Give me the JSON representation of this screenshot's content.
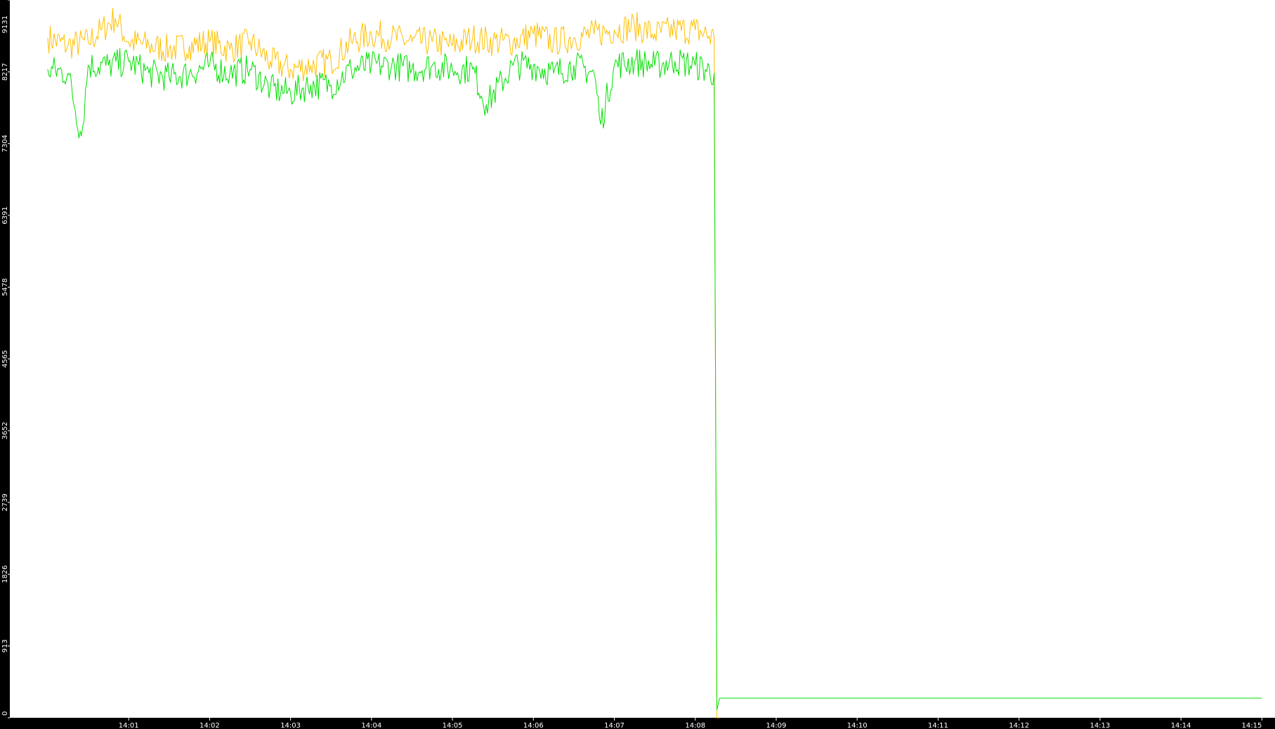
{
  "colors": {
    "background": "#000000",
    "plot_area": "#ffffff",
    "axis_text": "#ffffff",
    "series_orange": "#ffc000",
    "series_green": "#00e000"
  },
  "chart_data": {
    "type": "line",
    "title": "",
    "xlabel": "",
    "ylabel": "",
    "grid": false,
    "ylim": [
      0,
      9131
    ],
    "xlim_minutes": [
      13.9922,
      14.2527
    ],
    "y_ticks": [
      {
        "value": 0,
        "label": "0"
      },
      {
        "value": 913,
        "label": "913"
      },
      {
        "value": 1826,
        "label": "1826"
      },
      {
        "value": 2739,
        "label": "2739"
      },
      {
        "value": 3652,
        "label": "3652"
      },
      {
        "value": 4565,
        "label": "4565"
      },
      {
        "value": 5478,
        "label": "5478"
      },
      {
        "value": 6391,
        "label": "6391"
      },
      {
        "value": 7304,
        "label": "7304"
      },
      {
        "value": 8217,
        "label": "8217"
      },
      {
        "value": 9131,
        "label": "9131"
      }
    ],
    "x_ticks": [
      {
        "value": "14:01",
        "label": "14:01"
      },
      {
        "value": "14:02",
        "label": "14:02"
      },
      {
        "value": "14:03",
        "label": "14:03"
      },
      {
        "value": "14:04",
        "label": "14:04"
      },
      {
        "value": "14:05",
        "label": "14:05"
      },
      {
        "value": "14:06",
        "label": "14:06"
      },
      {
        "value": "14:07",
        "label": "14:07"
      },
      {
        "value": "14:08",
        "label": "14:08"
      },
      {
        "value": "14:09",
        "label": "14:09"
      },
      {
        "value": "14:10",
        "label": "14:10"
      },
      {
        "value": "14:11",
        "label": "14:11"
      },
      {
        "value": "14:12",
        "label": "14:12"
      },
      {
        "value": "14:13",
        "label": "14:13"
      },
      {
        "value": "14:14",
        "label": "14:14"
      },
      {
        "value": "14:15",
        "label": "14:15"
      }
    ],
    "series": [
      {
        "color": "#ffc000",
        "x": [
          "14:00:00",
          "14:00:15",
          "14:00:30",
          "14:00:40",
          "14:00:50",
          "14:01:00",
          "14:01:15",
          "14:01:30",
          "14:01:45",
          "14:02:00",
          "14:02:15",
          "14:02:30",
          "14:02:45",
          "14:03:00",
          "14:03:15",
          "14:03:30",
          "14:03:45",
          "14:04:00",
          "14:04:15",
          "14:04:30",
          "14:04:45",
          "14:05:00",
          "14:05:15",
          "14:05:30",
          "14:05:45",
          "14:06:00",
          "14:06:15",
          "14:06:30",
          "14:06:45",
          "14:07:00",
          "14:07:15",
          "14:07:30",
          "14:07:45",
          "14:08:00",
          "14:08:14",
          "14:08:16",
          "14:08:18"
        ],
        "y": [
          8650,
          8550,
          8600,
          8750,
          8900,
          8600,
          8550,
          8500,
          8550,
          8600,
          8500,
          8600,
          8350,
          8250,
          8300,
          8350,
          8600,
          8700,
          8650,
          8600,
          8600,
          8550,
          8650,
          8600,
          8600,
          8700,
          8600,
          8650,
          8700,
          8750,
          8800,
          8700,
          8750,
          8750,
          8650,
          0,
          0
        ]
      },
      {
        "color": "#00e000",
        "x": [
          "14:00:00",
          "14:00:15",
          "14:00:25",
          "14:00:30",
          "14:00:45",
          "14:01:00",
          "14:01:15",
          "14:01:30",
          "14:01:45",
          "14:02:00",
          "14:02:15",
          "14:02:30",
          "14:02:45",
          "14:03:00",
          "14:03:15",
          "14:03:30",
          "14:03:45",
          "14:04:00",
          "14:04:15",
          "14:04:30",
          "14:04:45",
          "14:05:00",
          "14:05:15",
          "14:05:25",
          "14:05:45",
          "14:06:00",
          "14:06:15",
          "14:06:30",
          "14:06:45",
          "14:06:50",
          "14:07:00",
          "14:07:15",
          "14:07:30",
          "14:07:45",
          "14:08:00",
          "14:08:14",
          "14:08:15",
          "14:08:16",
          "14:08:18",
          "14:15:00"
        ],
        "y": [
          8250,
          8200,
          7400,
          8300,
          8300,
          8350,
          8200,
          8150,
          8200,
          8300,
          8200,
          8250,
          8000,
          7950,
          8050,
          8050,
          8250,
          8300,
          8300,
          8250,
          8300,
          8250,
          8250,
          7800,
          8300,
          8300,
          8200,
          8300,
          8200,
          7550,
          8300,
          8350,
          8300,
          8350,
          8300,
          8200,
          4300,
          100,
          250,
          250
        ]
      }
    ]
  }
}
